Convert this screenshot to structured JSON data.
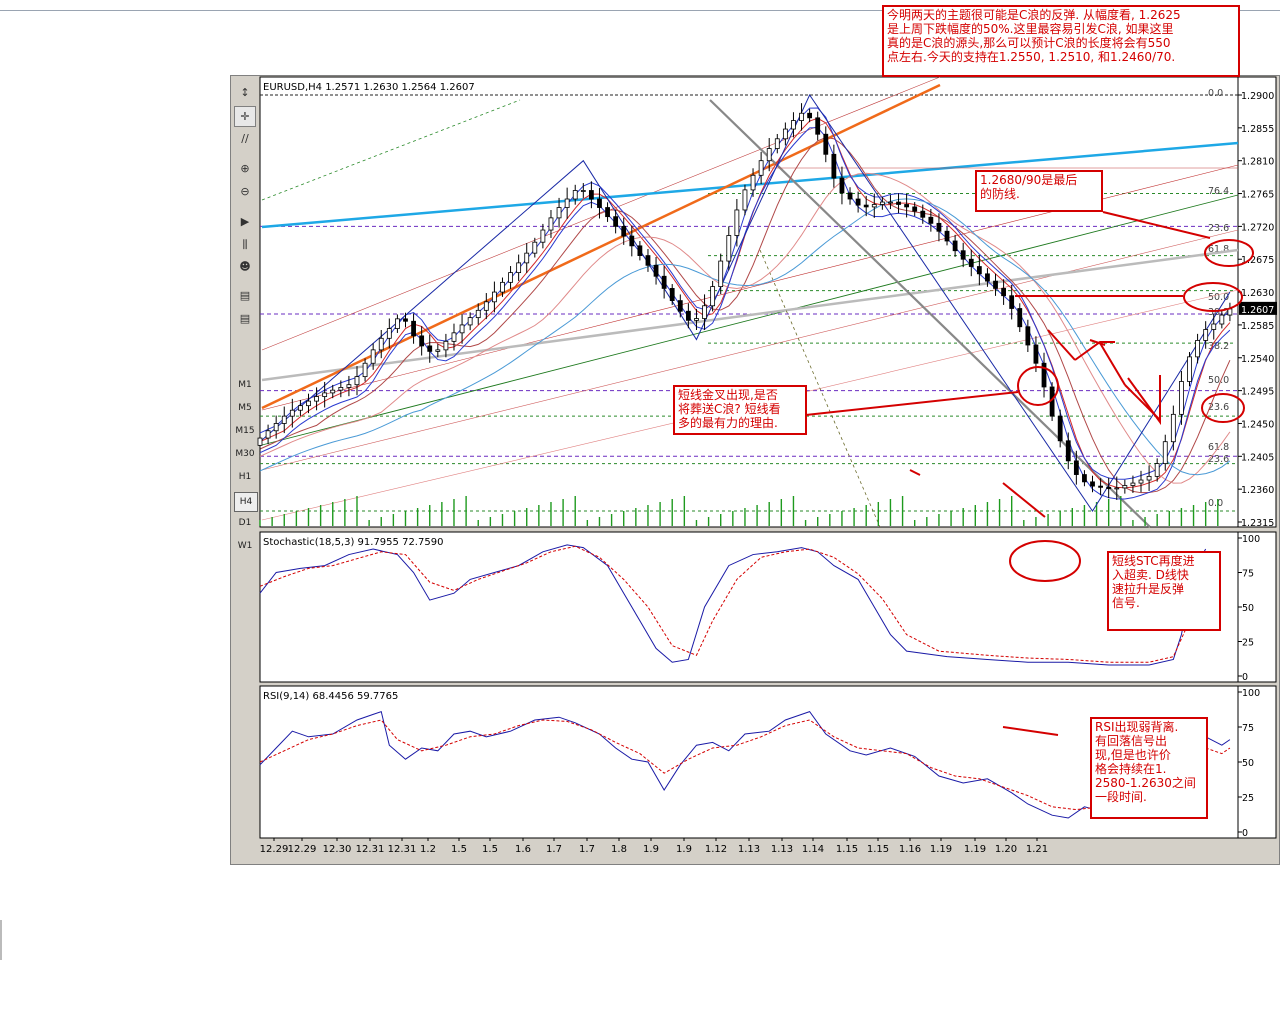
{
  "chart_data": [
    {
      "type": "candlestick",
      "title": "EURUSD,H4  1.2571  1.2630  1.2564  1.2607",
      "current_price": "1.2607",
      "y_ticks": [
        "1.2900",
        "1.2855",
        "1.2810",
        "1.2765",
        "1.2720",
        "1.2675",
        "1.2630",
        "1.2585",
        "1.2540",
        "1.2495",
        "1.2450",
        "1.2405",
        "1.2360",
        "1.2315"
      ],
      "ylim": [
        1.2298,
        1.2925
      ],
      "x_ticks": [
        "12.29",
        "12.29",
        "12.30",
        "12.31",
        "12.31",
        "1.2",
        "1.5",
        "1.5",
        "1.6",
        "1.7",
        "1.7",
        "1.8",
        "1.9",
        "1.9",
        "1.12",
        "1.13",
        "1.13",
        "1.14",
        "1.15",
        "1.15",
        "1.16",
        "1.19",
        "1.19",
        "1.20",
        "1.21"
      ],
      "fib_labels": [
        "0.0",
        "76.4",
        "23.6",
        "61.8",
        "50.0",
        "38.2",
        "38.2",
        "50.0",
        "23.6",
        "61.8",
        "23.6",
        "0.0"
      ],
      "close_path": [
        [
          0,
          1.2425
        ],
        [
          8,
          1.2465
        ],
        [
          16,
          1.249
        ],
        [
          24,
          1.2505
        ],
        [
          30,
          1.256
        ],
        [
          36,
          1.26
        ],
        [
          40,
          1.256
        ],
        [
          44,
          1.2545
        ],
        [
          50,
          1.258
        ],
        [
          56,
          1.261
        ],
        [
          62,
          1.265
        ],
        [
          68,
          1.269
        ],
        [
          74,
          1.274
        ],
        [
          80,
          1.2775
        ],
        [
          86,
          1.274
        ],
        [
          92,
          1.27
        ],
        [
          98,
          1.266
        ],
        [
          104,
          1.261
        ],
        [
          108,
          1.2585
        ],
        [
          112,
          1.262
        ],
        [
          116,
          1.269
        ],
        [
          120,
          1.276
        ],
        [
          126,
          1.282
        ],
        [
          132,
          1.286
        ],
        [
          136,
          1.288
        ],
        [
          140,
          1.2835
        ],
        [
          144,
          1.277
        ],
        [
          150,
          1.2745
        ],
        [
          156,
          1.2755
        ],
        [
          162,
          1.2745
        ],
        [
          168,
          1.272
        ],
        [
          174,
          1.268
        ],
        [
          180,
          1.265
        ],
        [
          186,
          1.262
        ],
        [
          190,
          1.257
        ],
        [
          194,
          1.252
        ],
        [
          198,
          1.244
        ],
        [
          202,
          1.2385
        ],
        [
          206,
          1.2365
        ],
        [
          212,
          1.236
        ],
        [
          218,
          1.237
        ],
        [
          222,
          1.238
        ],
        [
          226,
          1.244
        ],
        [
          230,
          1.253
        ],
        [
          234,
          1.2575
        ],
        [
          238,
          1.259
        ],
        [
          240,
          1.2607
        ]
      ]
    },
    {
      "type": "line",
      "title": "Stochastic(18,5,3)  91.7955  72.7590",
      "ylim": [
        0,
        100
      ],
      "y_ticks": [
        "100",
        "75",
        "50",
        "25",
        "0"
      ],
      "series": [
        {
          "values": [
            [
              0,
              60
            ],
            [
              4,
              75
            ],
            [
              10,
              78
            ],
            [
              16,
              80
            ],
            [
              22,
              88
            ],
            [
              28,
              92
            ],
            [
              34,
              88
            ],
            [
              38,
              75
            ],
            [
              42,
              55
            ],
            [
              48,
              60
            ],
            [
              52,
              70
            ],
            [
              58,
              75
            ],
            [
              64,
              80
            ],
            [
              70,
              90
            ],
            [
              76,
              95
            ],
            [
              80,
              93
            ],
            [
              86,
              80
            ],
            [
              90,
              60
            ],
            [
              94,
              40
            ],
            [
              98,
              20
            ],
            [
              102,
              10
            ],
            [
              106,
              12
            ],
            [
              110,
              50
            ],
            [
              116,
              80
            ],
            [
              122,
              88
            ],
            [
              128,
              90
            ],
            [
              134,
              93
            ],
            [
              138,
              90
            ],
            [
              142,
              80
            ],
            [
              148,
              70
            ],
            [
              152,
              50
            ],
            [
              156,
              30
            ],
            [
              160,
              18
            ],
            [
              170,
              14
            ],
            [
              180,
              12
            ],
            [
              190,
              10
            ],
            [
              200,
              10
            ],
            [
              210,
              8
            ],
            [
              220,
              8
            ],
            [
              226,
              12
            ],
            [
              228,
              30
            ],
            [
              230,
              60
            ],
            [
              232,
              82
            ],
            [
              234,
              92
            ]
          ]
        },
        {
          "values": [
            [
              0,
              65
            ],
            [
              6,
              72
            ],
            [
              12,
              78
            ],
            [
              18,
              80
            ],
            [
              24,
              85
            ],
            [
              30,
              90
            ],
            [
              36,
              88
            ],
            [
              42,
              68
            ],
            [
              48,
              62
            ],
            [
              54,
              70
            ],
            [
              60,
              76
            ],
            [
              66,
              82
            ],
            [
              72,
              90
            ],
            [
              78,
              94
            ],
            [
              84,
              86
            ],
            [
              90,
              70
            ],
            [
              96,
              50
            ],
            [
              102,
              22
            ],
            [
              108,
              15
            ],
            [
              112,
              40
            ],
            [
              118,
              70
            ],
            [
              124,
              86
            ],
            [
              130,
              90
            ],
            [
              136,
              92
            ],
            [
              142,
              86
            ],
            [
              148,
              74
            ],
            [
              154,
              56
            ],
            [
              160,
              30
            ],
            [
              168,
              18
            ],
            [
              180,
              15
            ],
            [
              190,
              13
            ],
            [
              200,
              12
            ],
            [
              210,
              10
            ],
            [
              220,
              10
            ],
            [
              226,
              14
            ],
            [
              230,
              40
            ],
            [
              234,
              73
            ]
          ]
        }
      ]
    },
    {
      "type": "line",
      "title": "RSI(9,14)  68.4456  59.7765",
      "ylim": [
        0,
        100
      ],
      "y_ticks": [
        "100",
        "75",
        "50",
        "25",
        "0"
      ],
      "series": [
        {
          "values": [
            [
              0,
              48
            ],
            [
              4,
              60
            ],
            [
              8,
              72
            ],
            [
              12,
              68
            ],
            [
              18,
              70
            ],
            [
              24,
              80
            ],
            [
              28,
              84
            ],
            [
              30,
              86
            ],
            [
              32,
              62
            ],
            [
              36,
              52
            ],
            [
              40,
              60
            ],
            [
              44,
              58
            ],
            [
              48,
              70
            ],
            [
              52,
              72
            ],
            [
              56,
              68
            ],
            [
              62,
              72
            ],
            [
              68,
              80
            ],
            [
              74,
              82
            ],
            [
              78,
              78
            ],
            [
              84,
              70
            ],
            [
              88,
              60
            ],
            [
              92,
              52
            ],
            [
              96,
              50
            ],
            [
              100,
              30
            ],
            [
              104,
              48
            ],
            [
              108,
              62
            ],
            [
              112,
              64
            ],
            [
              116,
              58
            ],
            [
              120,
              70
            ],
            [
              126,
              72
            ],
            [
              130,
              80
            ],
            [
              136,
              86
            ],
            [
              140,
              70
            ],
            [
              146,
              58
            ],
            [
              150,
              55
            ],
            [
              156,
              60
            ],
            [
              162,
              54
            ],
            [
              168,
              40
            ],
            [
              174,
              35
            ],
            [
              180,
              38
            ],
            [
              186,
              28
            ],
            [
              190,
              20
            ],
            [
              196,
              12
            ],
            [
              200,
              10
            ],
            [
              204,
              18
            ],
            [
              208,
              15
            ],
            [
              212,
              25
            ],
            [
              218,
              22
            ],
            [
              222,
              25
            ],
            [
              226,
              36
            ],
            [
              230,
              58
            ],
            [
              234,
              68
            ],
            [
              238,
              62
            ],
            [
              240,
              66
            ]
          ]
        },
        {
          "values": [
            [
              0,
              50
            ],
            [
              6,
              58
            ],
            [
              12,
              66
            ],
            [
              18,
              70
            ],
            [
              24,
              76
            ],
            [
              30,
              80
            ],
            [
              34,
              66
            ],
            [
              40,
              58
            ],
            [
              46,
              62
            ],
            [
              52,
              68
            ],
            [
              58,
              70
            ],
            [
              64,
              76
            ],
            [
              70,
              80
            ],
            [
              76,
              79
            ],
            [
              82,
              73
            ],
            [
              88,
              64
            ],
            [
              94,
              56
            ],
            [
              100,
              42
            ],
            [
              106,
              52
            ],
            [
              112,
              60
            ],
            [
              118,
              62
            ],
            [
              124,
              68
            ],
            [
              130,
              76
            ],
            [
              136,
              80
            ],
            [
              142,
              68
            ],
            [
              148,
              60
            ],
            [
              154,
              58
            ],
            [
              160,
              56
            ],
            [
              166,
              46
            ],
            [
              172,
              40
            ],
            [
              178,
              38
            ],
            [
              184,
              32
            ],
            [
              190,
              26
            ],
            [
              196,
              18
            ],
            [
              202,
              16
            ],
            [
              208,
              18
            ],
            [
              214,
              22
            ],
            [
              220,
              24
            ],
            [
              226,
              32
            ],
            [
              230,
              48
            ],
            [
              234,
              60
            ],
            [
              238,
              56
            ],
            [
              240,
              60
            ]
          ]
        }
      ]
    }
  ],
  "toolbar": {
    "icon_names": [
      "cursor-icon",
      "crosshair-icon",
      "line-tool-icon",
      "fib-tool-icon",
      "zoom-in-icon",
      "zoom-out-icon",
      "autoscroll-icon",
      "chart-shift-icon",
      "expert-icon",
      "periods-icon",
      "template-icon"
    ],
    "timeframes": [
      "M1",
      "M5",
      "M15",
      "M30",
      "H1",
      "H4",
      "D1",
      "W1"
    ],
    "selected_timeframe": "H4"
  },
  "annotations": {
    "top_note": [
      "今明两天的主题很可能是C浪的反弹. 从幅度看, 1.2625",
      "是上周下跌幅度的50%.这里最容易引发C浪, 如果这里",
      "真的是C浪的源头,那么可以预计C浪的长度将会有550",
      "点左右.今天的支持在1.2550, 1.2510, 和1.2460/70."
    ],
    "defense_note": [
      "1.2680/90是最后",
      "的防线."
    ],
    "crossover_note": [
      "短线金叉出现,是否",
      "将葬送C浪? 短线看",
      "多的最有力的理由."
    ],
    "stc_note": [
      "短线STC再度进",
      "入超卖. D线快",
      "速拉升是反弹",
      "信号."
    ],
    "rsi_note": [
      "RSI出现弱背离.",
      "有回落信号出",
      "现,但是也许价",
      "格会持续在1.",
      "2580-1.2630之间",
      "一段时间."
    ]
  },
  "colors": {
    "annotation": "#d40000",
    "stoch_main": "#1a1aa6",
    "stoch_signal": "#d40000",
    "volume": "#1e9a1e",
    "fib": "#6a2cc0",
    "cyan_line": "#1ea8e6",
    "orange_line": "#f06a1a"
  }
}
